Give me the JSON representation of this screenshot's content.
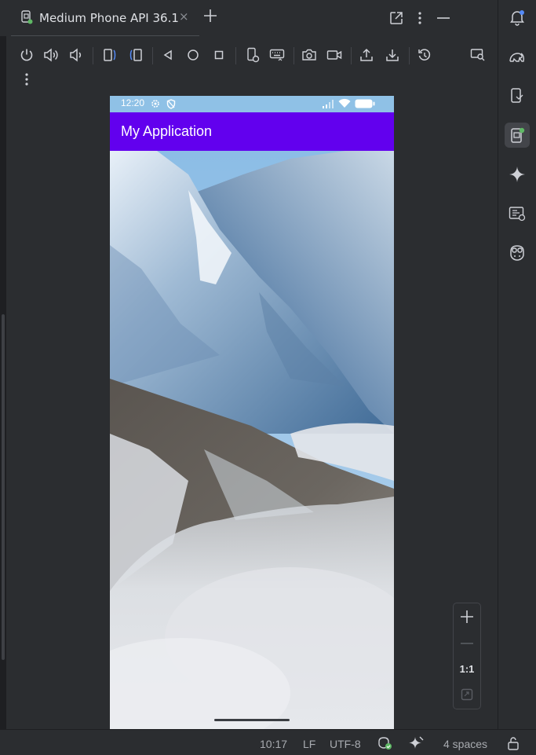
{
  "tab": {
    "title": "Medium Phone API 36.1",
    "close": "×"
  },
  "device": {
    "status_time": "12:20",
    "app_title": "My Application"
  },
  "zoom": {
    "actual_size_label": "1:1"
  },
  "statusbar": {
    "position": "10:17",
    "line_separator": "LF",
    "encoding": "UTF-8",
    "indent": "4 spaces"
  },
  "colors": {
    "app_bar": "#6200ee",
    "ide_background": "#2b2d30",
    "accent_blue": "#548af7",
    "accent_green": "#5fb865"
  },
  "icons": {
    "toolbar": [
      "power-icon",
      "volume-up-icon",
      "volume-down-icon",
      "rotate-left-icon",
      "rotate-right-icon",
      "back-icon",
      "home-icon",
      "overview-icon",
      "device-settings-icon",
      "keyboard-icon",
      "screenshot-icon",
      "screen-record-icon",
      "upload-icon",
      "download-icon",
      "snapshot-icon",
      "inspect-icon",
      "more-icon"
    ],
    "right_strip": [
      "notifications-icon",
      "gradle-icon",
      "device-manager-icon",
      "running-devices-icon",
      "gemini-icon",
      "logcat-icon",
      "copilot-icon"
    ]
  }
}
